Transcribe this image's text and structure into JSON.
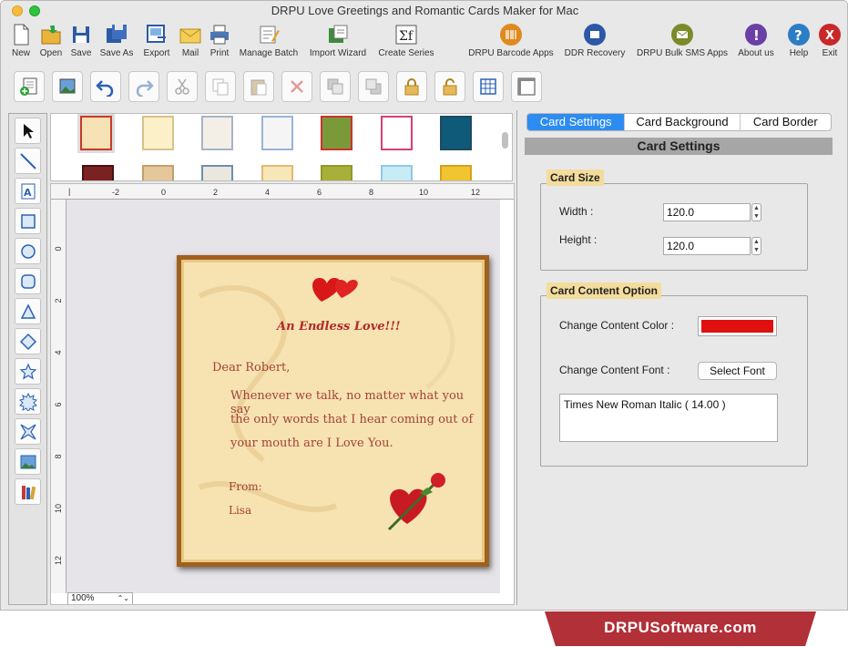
{
  "window": {
    "title": "DRPU Love Greetings and Romantic Cards Maker for Mac"
  },
  "toolbar": {
    "items": [
      {
        "label": "New"
      },
      {
        "label": "Open"
      },
      {
        "label": "Save"
      },
      {
        "label": "Save As"
      },
      {
        "label": "Export"
      },
      {
        "label": "Mail"
      },
      {
        "label": "Print"
      },
      {
        "label": "Manage Batch"
      },
      {
        "label": "Import Wizard"
      },
      {
        "label": "Create Series"
      }
    ],
    "right_items": [
      {
        "label": "DRPU Barcode Apps"
      },
      {
        "label": "DDR Recovery"
      },
      {
        "label": "DRPU Bulk SMS Apps"
      },
      {
        "label": "About us"
      },
      {
        "label": "Help"
      },
      {
        "label": "Exit"
      }
    ]
  },
  "rulers": {
    "h_labels": [
      "-2",
      "0",
      "2",
      "4",
      "6",
      "8",
      "10",
      "12"
    ],
    "v_labels": [
      "0",
      "2",
      "4",
      "6",
      "8",
      "10",
      "12"
    ]
  },
  "card": {
    "heading": "An Endless Love!!!",
    "greeting": "Dear Robert,",
    "body_lines": [
      "Whenever we talk, no matter what you say",
      "the only words that I hear coming out of",
      "your mouth are I Love You."
    ],
    "from_label": "From:",
    "signer": "Lisa"
  },
  "zoom": {
    "value": "100%"
  },
  "panel": {
    "tabs": [
      {
        "label": "Card Settings",
        "active": true
      },
      {
        "label": "Card Background",
        "active": false
      },
      {
        "label": "Card Border",
        "active": false
      }
    ],
    "header": "Card Settings",
    "card_size": {
      "title": "Card Size",
      "width_label": "Width :",
      "width_value": "120.0",
      "height_label": "Height :",
      "height_value": "120.0"
    },
    "content_option": {
      "title": "Card Content Option",
      "color_label": "Change Content Color :",
      "color_value": "#e01010",
      "font_label": "Change Content Font :",
      "select_font": "Select Font",
      "font_display": "Times New Roman Italic ( 14.00 )"
    }
  },
  "footer": {
    "brand": "DRPUSoftware.com"
  }
}
